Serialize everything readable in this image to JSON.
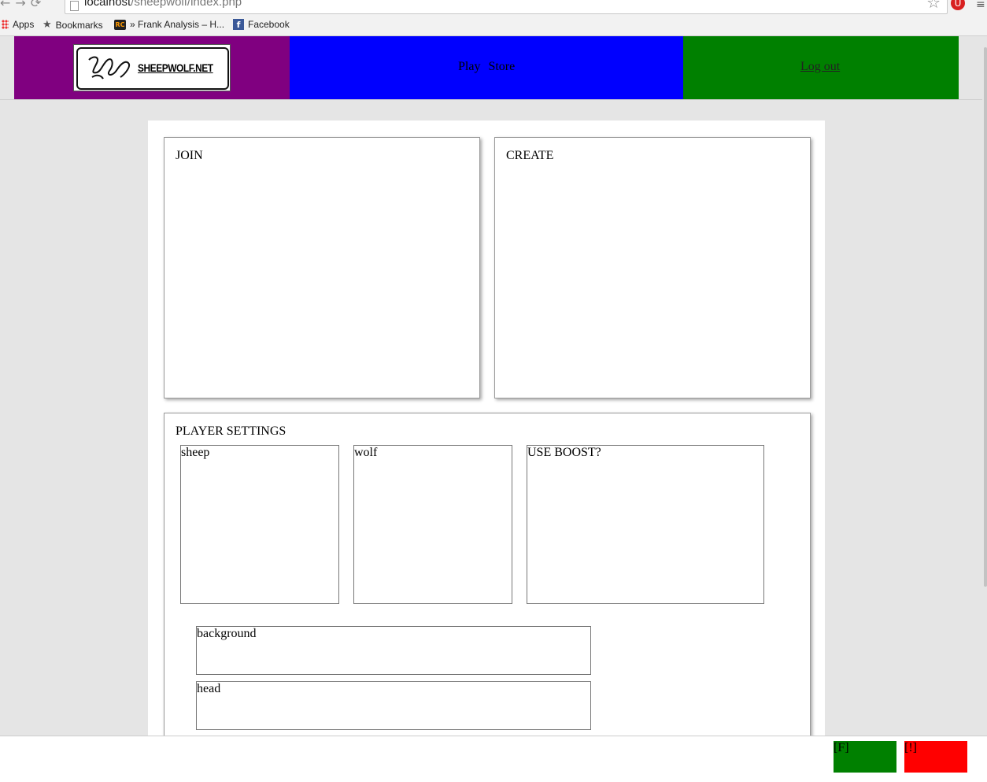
{
  "browser": {
    "url_host": "localhost",
    "url_path": "/sheepwolf/index.php",
    "bookmarks": [
      {
        "label": "Apps",
        "icon": "apps-icon"
      },
      {
        "label": "Bookmarks",
        "icon": "star-icon"
      },
      {
        "label": "» Frank Analysis – H...",
        "icon": "site-favicon"
      },
      {
        "label": "Facebook",
        "icon": "facebook-icon"
      }
    ]
  },
  "header": {
    "logo_text": "SHEEPWOLF.NET",
    "nav": [
      {
        "label": "Play"
      },
      {
        "label": "Store"
      }
    ],
    "logout_label": "Log out",
    "colors": {
      "logo_bg": "#800080",
      "nav_bg": "#0000ff",
      "logout_bg": "#008000"
    }
  },
  "main": {
    "join_title": "JOIN",
    "create_title": "CREATE",
    "settings": {
      "title": "PLAYER SETTINGS",
      "sheep_label": "sheep",
      "wolf_label": "wolf",
      "boost_label": "USE BOOST?",
      "background_label": "background",
      "head_label": "head"
    }
  },
  "footer": {
    "f_button": "[F]",
    "excl_button": "[!]",
    "colors": {
      "f_bg": "#008000",
      "excl_bg": "#ff0000"
    }
  }
}
